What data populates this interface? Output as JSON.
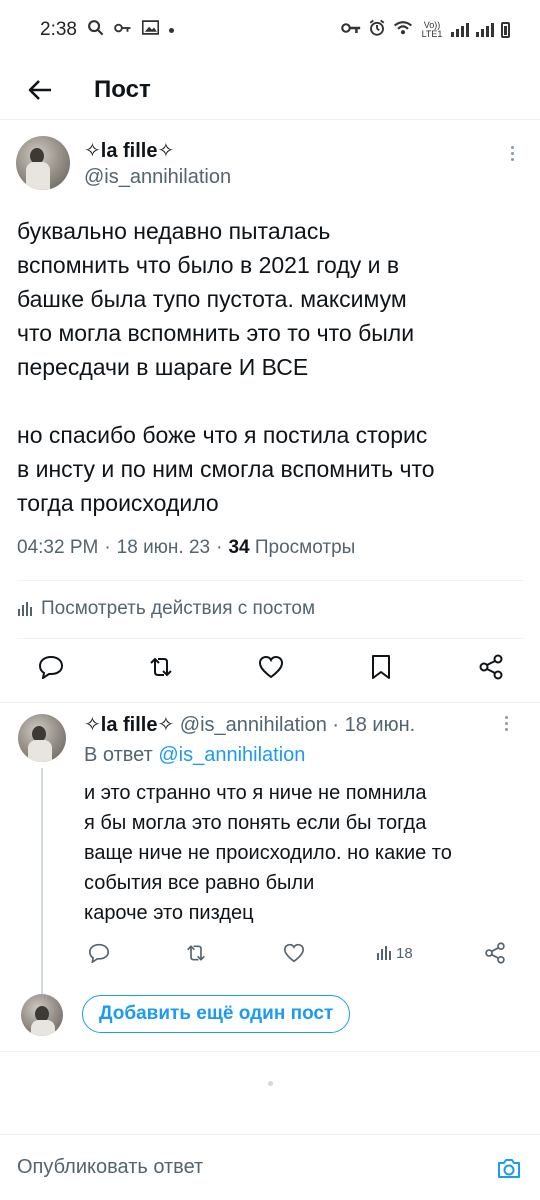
{
  "status_bar": {
    "time": "2:38",
    "network_label": "Vo)) LTE1"
  },
  "header": {
    "title": "Пост"
  },
  "post": {
    "display_name": "✧la fille✧",
    "handle": "@is_annihilation",
    "text": "буквально недавно пыталась\nвспомнить что было в 2021 году и в\nбашке была тупо пустота. максимум\nчто могла вспомнить это то что были\nпересдачи в шараге И ВСЕ\n\nно спасибо боже что я постила сторис\nв инсту и по ним смогла вспомнить что\nтогда происходило",
    "time": "04:32 PM",
    "date": "18 июн. 23",
    "views_count": "34",
    "views_label": "Просмотры",
    "activity_label": "Посмотреть действия с постом"
  },
  "reply": {
    "display_name": "✧la fille✧",
    "handle": "@is_annihilation",
    "date": "· 18 июн.",
    "reply_to_label": "В ответ",
    "reply_to_handle": "@is_annihilation",
    "text": "и это странно что я ниче не помнила\nя бы могла это понять если бы тогда\nваще ниче не происходило. но какие то\nсобытия все равно были\nкароче это пиздец",
    "views": "18"
  },
  "add_post": {
    "button_label": "Добавить ещё один пост"
  },
  "composer": {
    "placeholder": "Опубликовать ответ"
  },
  "colors": {
    "accent": "#1d9bf0",
    "text": "#0f1419",
    "secondary": "#536471",
    "border": "#eff3f4"
  }
}
